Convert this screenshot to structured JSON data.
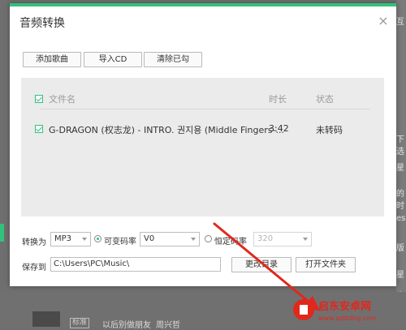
{
  "backdrop": {
    "right_fragments": [
      "互",
      "下选",
      "星",
      "的时",
      "es",
      "版",
      "星",
      "中"
    ],
    "bottom": {
      "badge": "标准",
      "song": "以后别做朋友",
      "artist": "周兴哲"
    }
  },
  "dialog": {
    "title": "音频转换",
    "close_symbol": "×",
    "toolbar": {
      "add_song": "添加歌曲",
      "import_cd": "导入CD",
      "clear_checked": "清除已勾"
    },
    "table": {
      "headers": {
        "filename": "文件名",
        "duration": "时长",
        "status": "状态"
      },
      "rows": [
        {
          "filename": "G-DRAGON (权志龙) - INTRO. 권지용 (Middle Fingers-...",
          "duration": "3:42",
          "status": "未转码",
          "checked": true
        }
      ]
    },
    "convert": {
      "label": "转换为",
      "format": "MP3",
      "vbr_label": "可变码率",
      "vbr_value": "V0",
      "cbr_label": "恒定码率",
      "cbr_value": "320"
    },
    "save": {
      "label": "保存到",
      "path": "C:\\Users\\PC\\Music\\",
      "change_dir": "更改目录",
      "open_folder": "打开文件夹"
    }
  },
  "watermark": {
    "brand": "启东安卓网",
    "url": "www.qdltdhg.com"
  },
  "colors": {
    "accent": "#31c27c",
    "arrow": "#e0281c"
  }
}
